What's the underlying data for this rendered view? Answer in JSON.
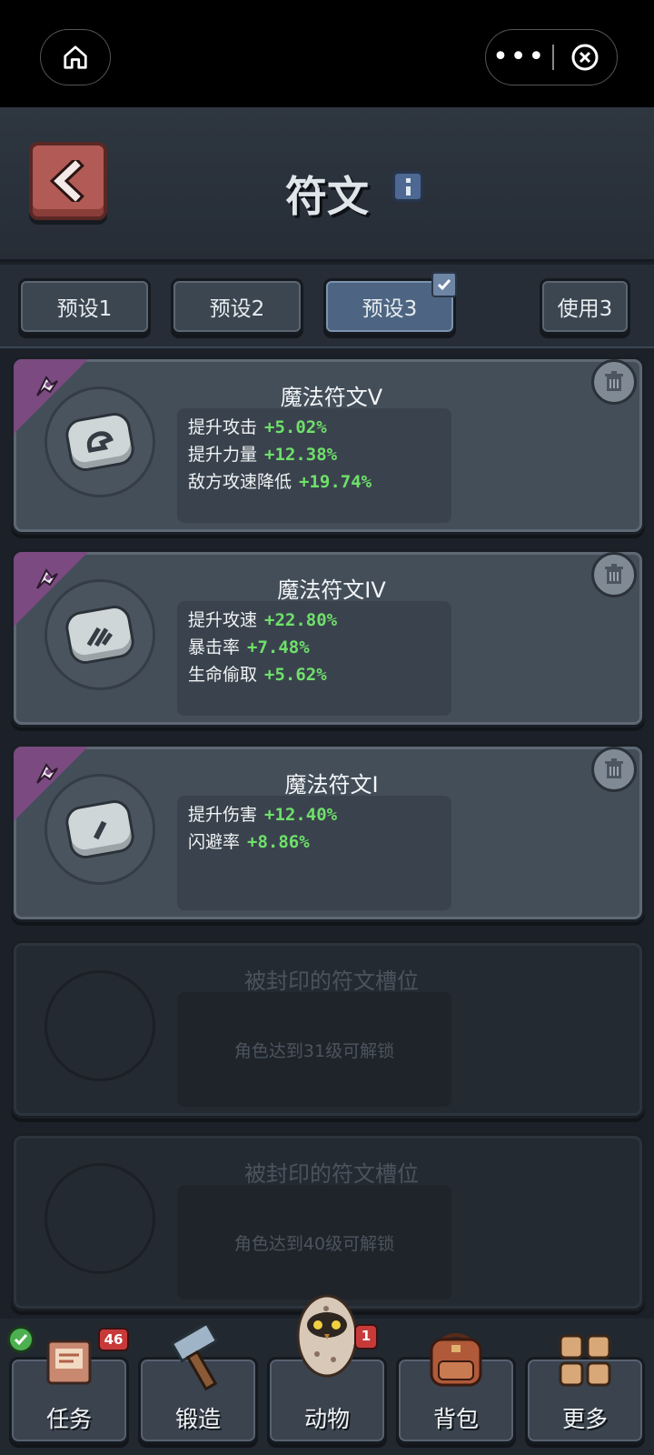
{
  "header": {
    "title": "符文"
  },
  "presets": [
    {
      "label": "预设1",
      "active": false
    },
    {
      "label": "预设2",
      "active": false
    },
    {
      "label": "预设3",
      "active": true
    }
  ],
  "use_button": "使用3",
  "runes": [
    {
      "name": "魔法符文V",
      "stats": [
        {
          "label": "提升攻击",
          "value": "+5.02%"
        },
        {
          "label": "提升力量",
          "value": "+12.38%"
        },
        {
          "label": "敌方攻速降低",
          "value": "+19.74%"
        }
      ]
    },
    {
      "name": "魔法符文IV",
      "stats": [
        {
          "label": "提升攻速",
          "value": "+22.80%"
        },
        {
          "label": "暴击率",
          "value": "+7.48%"
        },
        {
          "label": "生命偷取",
          "value": "+5.62%"
        }
      ]
    },
    {
      "name": "魔法符文I",
      "stats": [
        {
          "label": "提升伤害",
          "value": "+12.40%"
        },
        {
          "label": "闪避率",
          "value": "+8.86%"
        }
      ]
    }
  ],
  "locked_slots": [
    {
      "title": "被封印的符文槽位",
      "message": "角色达到31级可解锁"
    },
    {
      "title": "被封印的符文槽位",
      "message": "角色达到40级可解锁"
    }
  ],
  "nav": [
    {
      "label": "任务",
      "badge": "46",
      "icon": "task-icon"
    },
    {
      "label": "锻造",
      "icon": "hammer-icon"
    },
    {
      "label": "动物",
      "badge": "1",
      "icon": "owl-icon"
    },
    {
      "label": "背包",
      "icon": "backpack-icon"
    },
    {
      "label": "更多",
      "icon": "grid-icon"
    }
  ],
  "colors": {
    "stat_value": "#6fe06a",
    "back_button": "#b25a55",
    "rarity_corner": "#7a4a80"
  }
}
